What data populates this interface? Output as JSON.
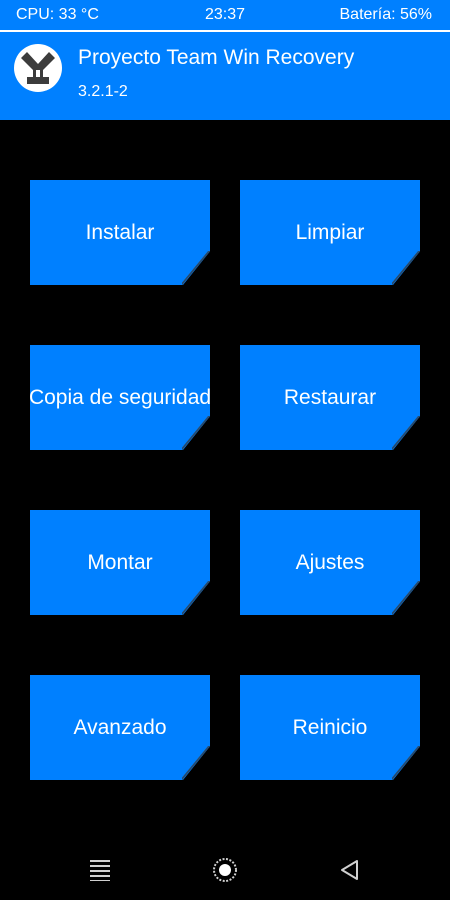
{
  "status_bar": {
    "cpu": "CPU: 33 °C",
    "time": "23:37",
    "battery": "Batería: 56%"
  },
  "header": {
    "title": "Proyecto Team Win Recovery",
    "version": "3.2.1-2",
    "logo_icon": "twrp-logo-icon"
  },
  "menu": {
    "items": [
      {
        "label": "Instalar"
      },
      {
        "label": "Limpiar"
      },
      {
        "label": "Copia de seguridad"
      },
      {
        "label": "Restaurar"
      },
      {
        "label": "Montar"
      },
      {
        "label": "Ajustes"
      },
      {
        "label": "Avanzado"
      },
      {
        "label": "Reinicio"
      }
    ]
  },
  "nav_bar": {
    "icons": [
      "menu-lines-icon",
      "home-circle-icon",
      "back-triangle-icon"
    ]
  },
  "colors": {
    "accent": "#0080ff",
    "background": "#000000",
    "text": "#ffffff"
  }
}
